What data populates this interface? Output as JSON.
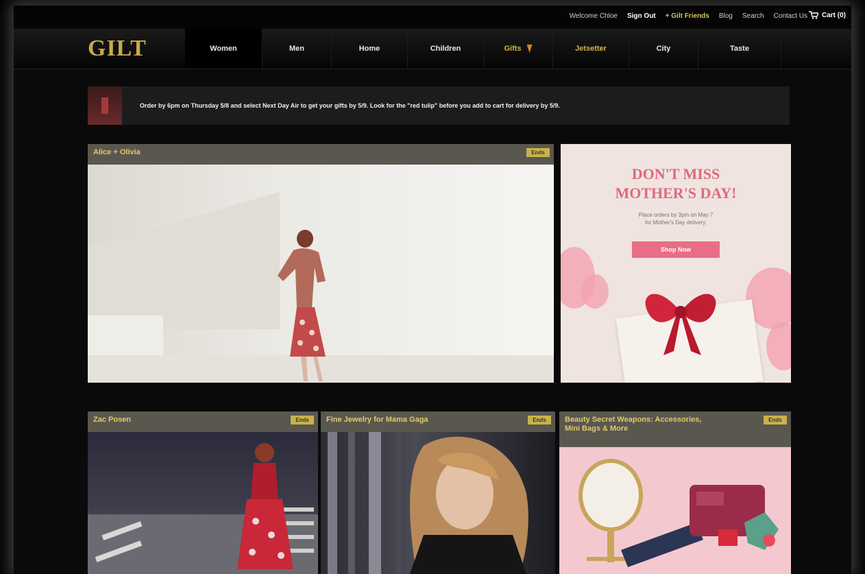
{
  "utility": {
    "welcome": "Welcome Chloe",
    "sign_out": "Sign Out",
    "gilt_friends": "+ Gilt Friends",
    "blog": "Blog",
    "search": "Search",
    "contact": "Contact Us",
    "cart": "Cart (0)"
  },
  "logo": "GILT",
  "nav": [
    {
      "label": "Women",
      "active": true
    },
    {
      "label": "Men"
    },
    {
      "label": "Home"
    },
    {
      "label": "Children"
    },
    {
      "label": "Gifts"
    },
    {
      "label": "Jetsetter"
    },
    {
      "label": "City"
    },
    {
      "label": "Taste"
    }
  ],
  "announcement": "Order by 6pm on Thursday 5/8 and select Next Day Air to get your gifts by 5/9. Look for the \"red tulip\" before you add to cart for delivery by 5/9.",
  "cards": {
    "featured": {
      "title": "Alice + Olivia",
      "tag": "Ends"
    },
    "promo": {
      "title_line1": "DON'T MISS",
      "title_line2": "MOTHER'S DAY!",
      "sub_line1": "Place orders by 3pm on May 7",
      "sub_line2": "for Mother's Day delivery.",
      "button": "Shop Now"
    },
    "bottom": [
      {
        "title": "Zac Posen",
        "tag": "Ends"
      },
      {
        "title": "Fine Jewelry for Mama Gaga",
        "tag": "Ends"
      },
      {
        "title": "Beauty Secret Weapons: Accessories, Mini Bags & More",
        "tag": "Ends"
      }
    ]
  },
  "colors": {
    "gold": "#c9a94a",
    "pink": "#e86e84",
    "header_bg": "#5a574f"
  }
}
